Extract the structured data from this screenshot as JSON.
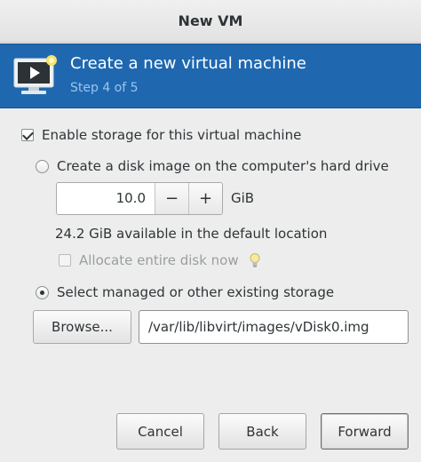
{
  "window": {
    "title": "New VM"
  },
  "banner": {
    "title": "Create a new virtual machine",
    "step": "Step 4 of 5",
    "icon": "monitor-new-icon"
  },
  "storage": {
    "enable_label": "Enable storage for this virtual machine",
    "enable_checked": true,
    "create_disk_label": "Create a disk image on the computer's hard drive",
    "size_value": "10.0",
    "minus_label": "−",
    "plus_label": "+",
    "unit": "GiB",
    "available_text": "24.2 GiB available in the default location",
    "allocate_label": "Allocate entire disk now",
    "allocate_checked": false,
    "select_existing_label": "Select managed or other existing storage",
    "browse_label": "Browse...",
    "path_value": "/var/lib/libvirt/images/vDisk0.img"
  },
  "buttons": {
    "cancel": "Cancel",
    "back": "Back",
    "forward": "Forward"
  },
  "colors": {
    "banner": "#1f68b0",
    "banner_step": "#9cc4ec",
    "background": "#ededed"
  }
}
